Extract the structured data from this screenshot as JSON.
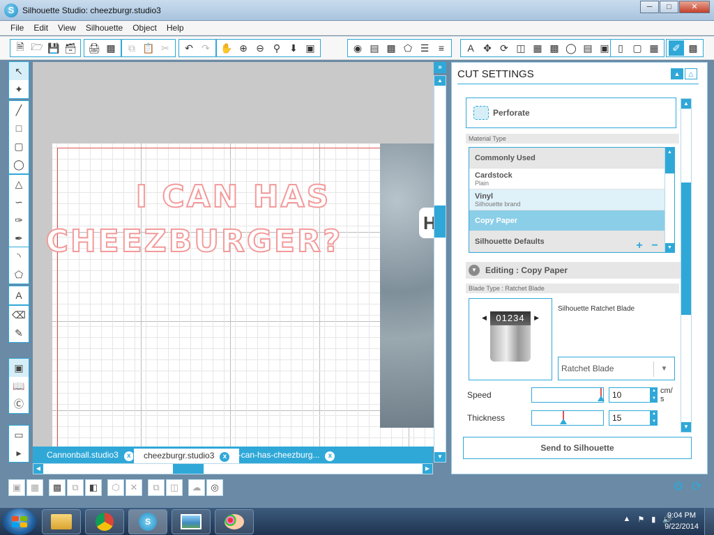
{
  "window": {
    "title": "Silhouette Studio: cheezburgr.studio3",
    "logo_letter": "S"
  },
  "menu": [
    "File",
    "Edit",
    "View",
    "Silhouette",
    "Object",
    "Help"
  ],
  "canvas": {
    "caption_line1": "I CAN HAS",
    "caption_line2": "CHEEZBURGER?",
    "sign_letter": "H",
    "caption_color": "#f39a9a"
  },
  "tabs": [
    {
      "label": "Cannonball.studio3",
      "close": "x"
    },
    {
      "label": "cheezburgr.studio3",
      "close": "x"
    },
    {
      "label": "i-can-has-cheezburg...",
      "close": "x"
    }
  ],
  "cut_settings": {
    "title": "CUT SETTINGS",
    "perforate_label": "Perforate",
    "material_type_label": "Material Type",
    "materials": [
      {
        "name": "Commonly Used",
        "sub": ""
      },
      {
        "name": "Cardstock",
        "sub": "Plain"
      },
      {
        "name": "Vinyl",
        "sub": "Silhouette brand"
      },
      {
        "name": "Copy Paper",
        "sub": ""
      },
      {
        "name": "Silhouette Defaults",
        "sub": ""
      }
    ],
    "add_label": "+",
    "remove_label": "−",
    "editing_label": "Editing : Copy Paper",
    "blade_type_label": "Blade Type : Ratchet Blade",
    "blade_dial": "01234",
    "blade_name": "Silhouette Ratchet Blade",
    "blade_select": "Ratchet Blade",
    "speed_label": "Speed",
    "speed_value": "10",
    "speed_unit_1": "cm/",
    "speed_unit_2": "s",
    "thickness_label": "Thickness",
    "thickness_value": "15",
    "send_button": "Send to Silhouette"
  },
  "taskbar": {
    "time": "9:04 PM",
    "date": "9/22/2014"
  },
  "colors": {
    "accent": "#2fa8d8",
    "guide": "#e05050"
  }
}
